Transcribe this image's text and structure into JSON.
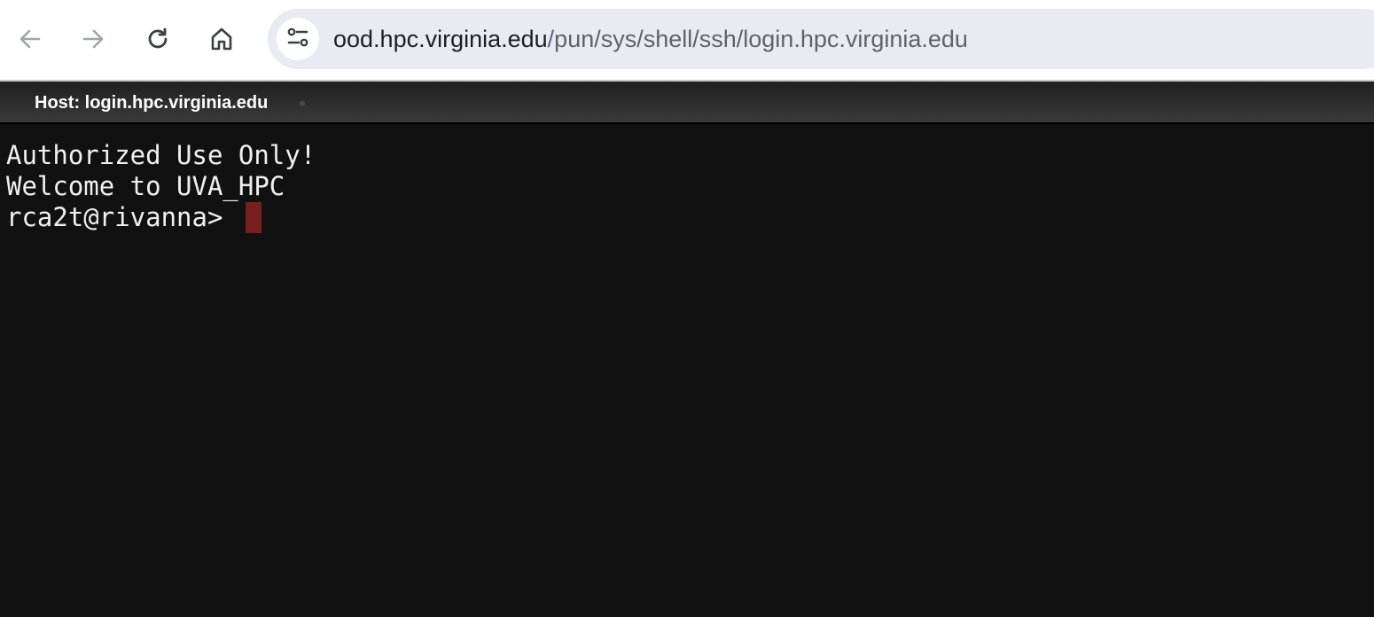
{
  "browser": {
    "back_icon": "arrow-left-icon",
    "forward_icon": "arrow-right-icon",
    "reload_icon": "reload-icon",
    "home_icon": "home-icon",
    "site_info_icon": "tune-icon",
    "url_host": "ood.hpc.virginia.edu",
    "url_path": "/pun/sys/shell/ssh/login.hpc.virginia.edu"
  },
  "terminal": {
    "host_label": "Host: login.hpc.virginia.edu",
    "lines": [
      "Authorized Use Only!",
      "Welcome to UVA_HPC",
      "rca2t@rivanna>"
    ],
    "cursor_color": "#7a1f1f"
  }
}
